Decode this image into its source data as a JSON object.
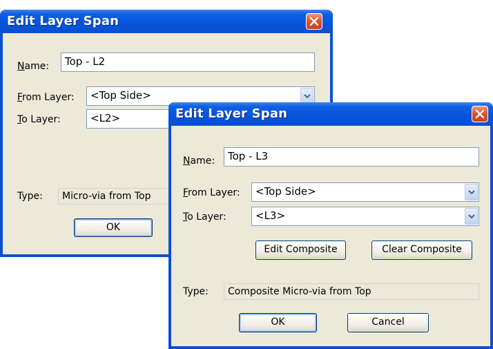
{
  "dialog1": {
    "title": "Edit Layer Span",
    "name_label_u": "N",
    "name_label_rest": "ame:",
    "name_value": "Top - L2",
    "from_label_u": "F",
    "from_label_rest": "rom Layer:",
    "from_value": "<Top Side>",
    "to_label_u": "T",
    "to_label_rest": "o Layer:",
    "to_value": "<L2>",
    "type_label": "Type:",
    "type_value": "Micro-via from Top",
    "ok_label": "OK"
  },
  "dialog2": {
    "title": "Edit Layer Span",
    "name_label_u": "N",
    "name_label_rest": "ame:",
    "name_value": "Top - L3",
    "from_label_u": "F",
    "from_label_rest": "rom Layer:",
    "from_value": "<Top Side>",
    "to_label_u": "T",
    "to_label_rest": "o Layer:",
    "to_value": "<L3>",
    "edit_composite_label": "Edit Composite",
    "clear_composite_label": "Clear Composite",
    "type_label": "Type:",
    "type_value": "Composite Micro-via from Top",
    "ok_label": "OK",
    "cancel_label": "Cancel"
  },
  "icons": {
    "close": "close-icon",
    "dropdown": "chevron-down-icon"
  },
  "colors": {
    "titlebar": "#0553da",
    "client": "#ece9d8",
    "close_button": "#e0542b",
    "field_border": "#7f9db9"
  }
}
